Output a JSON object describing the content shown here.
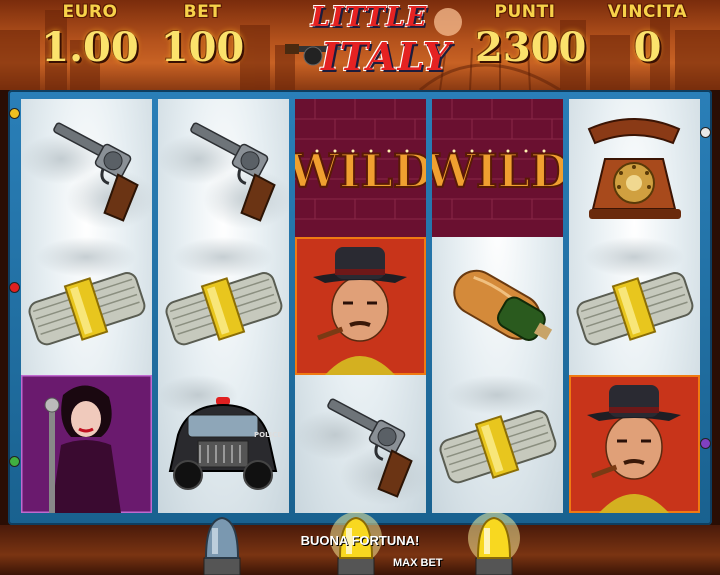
{
  "header": {
    "euro_label": "EURO",
    "euro_value": "1.00",
    "bet_label": "BET",
    "bet_value": "100",
    "punti_label": "PUNTI",
    "punti_value": "2300",
    "vincita_label": "VINCITA",
    "vincita_value": "0"
  },
  "logo": {
    "line1": "LITTLE",
    "line2": "ITALY"
  },
  "reels": [
    [
      "revolver",
      "money-stack",
      "lady-singer"
    ],
    [
      "revolver",
      "money-stack",
      "police-car"
    ],
    [
      "wild",
      "mobster",
      "revolver"
    ],
    [
      "wild",
      "bread-wine",
      "money-stack"
    ],
    [
      "telephone",
      "money-stack",
      "mobster"
    ]
  ],
  "wild_text": "WILD",
  "police_text": "POLICE",
  "footer": {
    "message": "BUONA FORTUNA!",
    "max_bet_label": "MAX BET"
  },
  "colors": {
    "accent_gold": "#f7d24a",
    "frame_blue": "#2a7fb8",
    "logo_red": "#e52222",
    "highlight_orange": "#f07a12"
  }
}
